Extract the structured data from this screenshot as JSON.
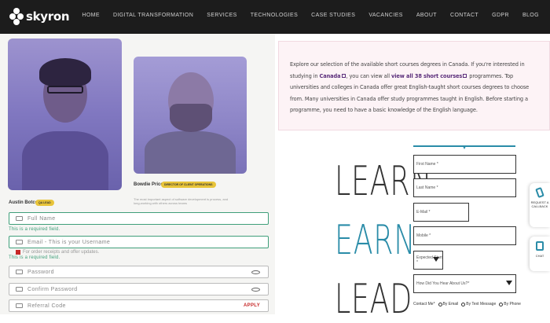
{
  "nav": {
    "brand": "skyron",
    "items": [
      "HOME",
      "DIGITAL TRANSFORMATION",
      "SERVICES",
      "TECHNOLOGIES",
      "CASE STUDIES",
      "VACANCIES",
      "ABOUT",
      "CONTACT",
      "GDPR",
      "BLOG"
    ]
  },
  "team": {
    "person1": {
      "name": "Austin Botcor",
      "role": "QA LEAD"
    },
    "person2": {
      "name": "Bowdie Price",
      "role": "DIRECTOR OF CLIENT OPERATIONS",
      "quote": "The most important aspect of software development is process, and long-working with others across teams"
    }
  },
  "signup": {
    "full_name_placeholder": "Full Name",
    "full_name_error": "This is a required field.",
    "email_placeholder": "Email - This is your Username",
    "consent_text": "For order receipts and offer updates.",
    "email_error": "This is a required field.",
    "password_placeholder": "Password",
    "confirm_password_placeholder": "Confirm Password",
    "referral_placeholder": "Referral Code",
    "apply_label": "APPLY"
  },
  "info": {
    "text_1": "Explore our selection of the available short courses degrees in Canada. If you're interested in studying in ",
    "link_canada": "Canada",
    "text_2": ", you can view all ",
    "link_view_all": "view all 38 short courses",
    "text_3": " programmes. Top universities and colleges in Canada offer great English-taught short courses degrees to choose from. Many universities in Canada offer study programmes taught in English. Before starting a programme, you need to have a basic knowledge of the English language."
  },
  "promo": {
    "word1": "LEARN",
    "word2": "EARN",
    "word3": "LEAD",
    "colors": {
      "word1": "#333333",
      "word2": "#2a8ca8",
      "word3": "#333333"
    }
  },
  "lead_form": {
    "first_name": "First Name *",
    "last_name": "Last Name *",
    "email": "E-Mail *",
    "mobile": "Mobile *",
    "expected_start": "Expected Start *",
    "how_heard": "How Did You Hear About Us?*",
    "contact_label": "Contact Me*",
    "contact_options": [
      "By Email",
      "By Text Message",
      "By Phone"
    ]
  },
  "side": {
    "callback_label": "REQUEST A CALLBACK",
    "chat_label": "CHAT"
  },
  "colors": {
    "nav_bg": "#1c1c1c",
    "accent_teal": "#2a8ca8",
    "valid_green": "#3f9f7a",
    "apply_red": "#c62828",
    "info_bg": "#fdf3f6"
  }
}
